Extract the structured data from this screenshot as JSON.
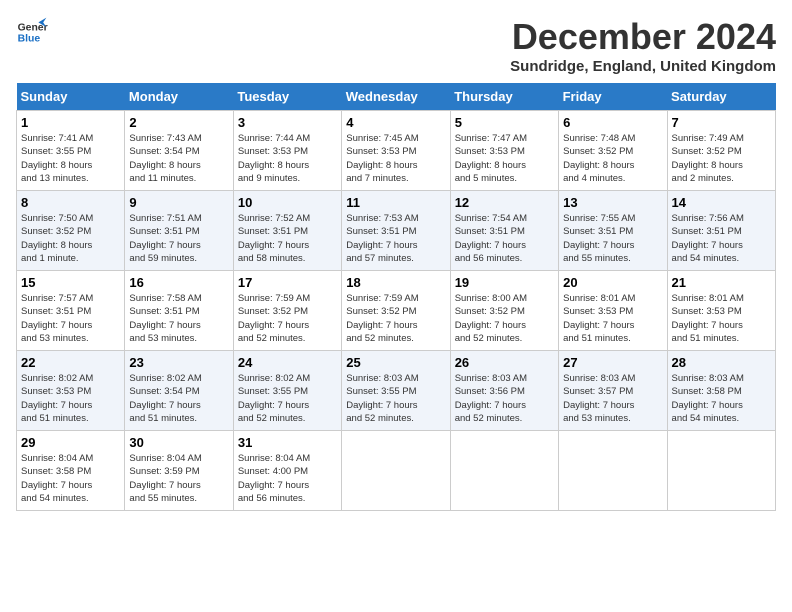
{
  "logo": {
    "line1": "General",
    "line2": "Blue"
  },
  "title": "December 2024",
  "subtitle": "Sundridge, England, United Kingdom",
  "days_header": [
    "Sunday",
    "Monday",
    "Tuesday",
    "Wednesday",
    "Thursday",
    "Friday",
    "Saturday"
  ],
  "weeks": [
    [
      {
        "num": "1",
        "info": "Sunrise: 7:41 AM\nSunset: 3:55 PM\nDaylight: 8 hours\nand 13 minutes."
      },
      {
        "num": "2",
        "info": "Sunrise: 7:43 AM\nSunset: 3:54 PM\nDaylight: 8 hours\nand 11 minutes."
      },
      {
        "num": "3",
        "info": "Sunrise: 7:44 AM\nSunset: 3:53 PM\nDaylight: 8 hours\nand 9 minutes."
      },
      {
        "num": "4",
        "info": "Sunrise: 7:45 AM\nSunset: 3:53 PM\nDaylight: 8 hours\nand 7 minutes."
      },
      {
        "num": "5",
        "info": "Sunrise: 7:47 AM\nSunset: 3:53 PM\nDaylight: 8 hours\nand 5 minutes."
      },
      {
        "num": "6",
        "info": "Sunrise: 7:48 AM\nSunset: 3:52 PM\nDaylight: 8 hours\nand 4 minutes."
      },
      {
        "num": "7",
        "info": "Sunrise: 7:49 AM\nSunset: 3:52 PM\nDaylight: 8 hours\nand 2 minutes."
      }
    ],
    [
      {
        "num": "8",
        "info": "Sunrise: 7:50 AM\nSunset: 3:52 PM\nDaylight: 8 hours\nand 1 minute."
      },
      {
        "num": "9",
        "info": "Sunrise: 7:51 AM\nSunset: 3:51 PM\nDaylight: 7 hours\nand 59 minutes."
      },
      {
        "num": "10",
        "info": "Sunrise: 7:52 AM\nSunset: 3:51 PM\nDaylight: 7 hours\nand 58 minutes."
      },
      {
        "num": "11",
        "info": "Sunrise: 7:53 AM\nSunset: 3:51 PM\nDaylight: 7 hours\nand 57 minutes."
      },
      {
        "num": "12",
        "info": "Sunrise: 7:54 AM\nSunset: 3:51 PM\nDaylight: 7 hours\nand 56 minutes."
      },
      {
        "num": "13",
        "info": "Sunrise: 7:55 AM\nSunset: 3:51 PM\nDaylight: 7 hours\nand 55 minutes."
      },
      {
        "num": "14",
        "info": "Sunrise: 7:56 AM\nSunset: 3:51 PM\nDaylight: 7 hours\nand 54 minutes."
      }
    ],
    [
      {
        "num": "15",
        "info": "Sunrise: 7:57 AM\nSunset: 3:51 PM\nDaylight: 7 hours\nand 53 minutes."
      },
      {
        "num": "16",
        "info": "Sunrise: 7:58 AM\nSunset: 3:51 PM\nDaylight: 7 hours\nand 53 minutes."
      },
      {
        "num": "17",
        "info": "Sunrise: 7:59 AM\nSunset: 3:52 PM\nDaylight: 7 hours\nand 52 minutes."
      },
      {
        "num": "18",
        "info": "Sunrise: 7:59 AM\nSunset: 3:52 PM\nDaylight: 7 hours\nand 52 minutes."
      },
      {
        "num": "19",
        "info": "Sunrise: 8:00 AM\nSunset: 3:52 PM\nDaylight: 7 hours\nand 52 minutes."
      },
      {
        "num": "20",
        "info": "Sunrise: 8:01 AM\nSunset: 3:53 PM\nDaylight: 7 hours\nand 51 minutes."
      },
      {
        "num": "21",
        "info": "Sunrise: 8:01 AM\nSunset: 3:53 PM\nDaylight: 7 hours\nand 51 minutes."
      }
    ],
    [
      {
        "num": "22",
        "info": "Sunrise: 8:02 AM\nSunset: 3:53 PM\nDaylight: 7 hours\nand 51 minutes."
      },
      {
        "num": "23",
        "info": "Sunrise: 8:02 AM\nSunset: 3:54 PM\nDaylight: 7 hours\nand 51 minutes."
      },
      {
        "num": "24",
        "info": "Sunrise: 8:02 AM\nSunset: 3:55 PM\nDaylight: 7 hours\nand 52 minutes."
      },
      {
        "num": "25",
        "info": "Sunrise: 8:03 AM\nSunset: 3:55 PM\nDaylight: 7 hours\nand 52 minutes."
      },
      {
        "num": "26",
        "info": "Sunrise: 8:03 AM\nSunset: 3:56 PM\nDaylight: 7 hours\nand 52 minutes."
      },
      {
        "num": "27",
        "info": "Sunrise: 8:03 AM\nSunset: 3:57 PM\nDaylight: 7 hours\nand 53 minutes."
      },
      {
        "num": "28",
        "info": "Sunrise: 8:03 AM\nSunset: 3:58 PM\nDaylight: 7 hours\nand 54 minutes."
      }
    ],
    [
      {
        "num": "29",
        "info": "Sunrise: 8:04 AM\nSunset: 3:58 PM\nDaylight: 7 hours\nand 54 minutes."
      },
      {
        "num": "30",
        "info": "Sunrise: 8:04 AM\nSunset: 3:59 PM\nDaylight: 7 hours\nand 55 minutes."
      },
      {
        "num": "31",
        "info": "Sunrise: 8:04 AM\nSunset: 4:00 PM\nDaylight: 7 hours\nand 56 minutes."
      },
      {
        "num": "",
        "info": ""
      },
      {
        "num": "",
        "info": ""
      },
      {
        "num": "",
        "info": ""
      },
      {
        "num": "",
        "info": ""
      }
    ]
  ]
}
